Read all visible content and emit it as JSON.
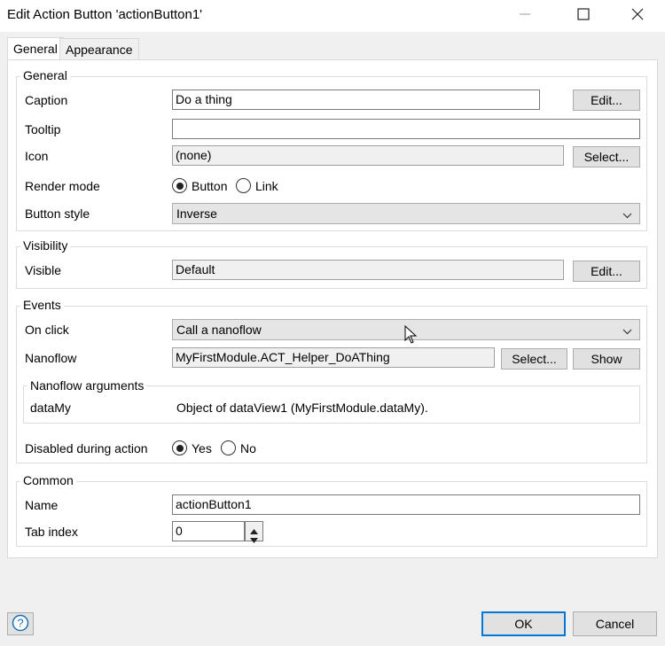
{
  "window": {
    "title": "Edit Action Button 'actionButton1'",
    "minimize_icon": "minimize-icon",
    "maximize_icon": "maximize-icon",
    "close_icon": "close-icon"
  },
  "tabs": [
    {
      "label": "General",
      "active": true
    },
    {
      "label": "Appearance",
      "active": false
    }
  ],
  "general": {
    "group_title": "General",
    "caption": {
      "label": "Caption",
      "value": "Do a thing",
      "button": "Edit..."
    },
    "tooltip": {
      "label": "Tooltip",
      "value": ""
    },
    "icon": {
      "label": "Icon",
      "value": "(none)",
      "button": "Select..."
    },
    "render_mode": {
      "label": "Render mode",
      "options": [
        "Button",
        "Link"
      ],
      "selected": "Button"
    },
    "button_style": {
      "label": "Button style",
      "value": "Inverse"
    }
  },
  "visibility": {
    "group_title": "Visibility",
    "visible": {
      "label": "Visible",
      "value": "Default",
      "button": "Edit..."
    }
  },
  "events": {
    "group_title": "Events",
    "on_click": {
      "label": "On click",
      "value": "Call a nanoflow"
    },
    "nanoflow": {
      "label": "Nanoflow",
      "value": "MyFirstModule.ACT_Helper_DoAThing",
      "select_button": "Select...",
      "show_button": "Show"
    },
    "arguments": {
      "title": "Nanoflow arguments",
      "rows": [
        {
          "name": "dataMy",
          "value": "Object of dataView1 (MyFirstModule.dataMy)."
        }
      ]
    },
    "disabled_during_action": {
      "label": "Disabled during action",
      "options": [
        "Yes",
        "No"
      ],
      "selected": "Yes"
    }
  },
  "common": {
    "group_title": "Common",
    "name": {
      "label": "Name",
      "value": "actionButton1"
    },
    "tab_index": {
      "label": "Tab index",
      "value": "0"
    }
  },
  "footer": {
    "help_icon": "help-icon",
    "ok": "OK",
    "cancel": "Cancel"
  }
}
